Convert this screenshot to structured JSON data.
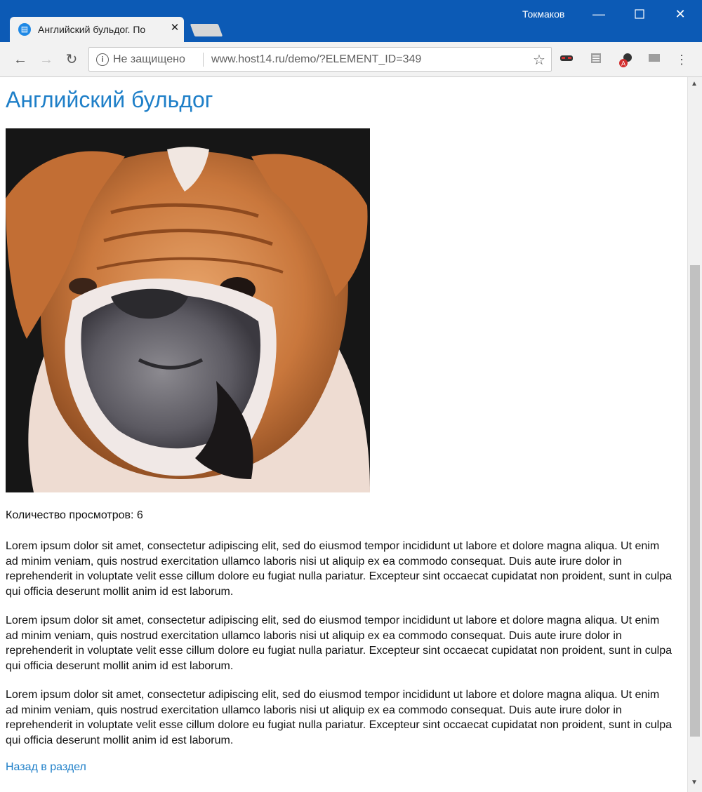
{
  "browser": {
    "tab_title": "Английский бульдог. По",
    "tab_close": "✕",
    "profile_name": "Токмаков",
    "security_text": "Не защищено",
    "url": "www.host14.ru/demo/?ELEMENT_ID=349",
    "accent_color": "#0c5ab5"
  },
  "page": {
    "title": "Английский бульдог",
    "views": "Количество просмотров: 6",
    "paragraphs": [
      "Lorem ipsum dolor sit amet, consectetur adipiscing elit, sed do eiusmod tempor incididunt ut labore et dolore magna aliqua. Ut enim ad minim veniam, quis nostrud exercitation ullamco laboris nisi ut aliquip ex ea commodo consequat. Duis aute irure dolor in reprehenderit in voluptate velit esse cillum dolore eu fugiat nulla pariatur. Excepteur sint occaecat cupidatat non proident, sunt in culpa qui officia deserunt mollit anim id est laborum.",
      "Lorem ipsum dolor sit amet, consectetur adipiscing elit, sed do eiusmod tempor incididunt ut labore et dolore magna aliqua. Ut enim ad minim veniam, quis nostrud exercitation ullamco laboris nisi ut aliquip ex ea commodo consequat. Duis aute irure dolor in reprehenderit in voluptate velit esse cillum dolore eu fugiat nulla pariatur. Excepteur sint occaecat cupidatat non proident, sunt in culpa qui officia deserunt mollit anim id est laborum.",
      "Lorem ipsum dolor sit amet, consectetur adipiscing elit, sed do eiusmod tempor incididunt ut labore et dolore magna aliqua. Ut enim ad minim veniam, quis nostrud exercitation ullamco laboris nisi ut aliquip ex ea commodo consequat. Duis aute irure dolor in reprehenderit in voluptate velit esse cillum dolore eu fugiat nulla pariatur. Excepteur sint occaecat cupidatat non proident, sunt in culpa qui officia deserunt mollit anim id est laborum."
    ],
    "back_link": "Назад в раздел",
    "link_color": "#1e7fc8"
  },
  "icons": {
    "favicon": "basket-icon",
    "back": "back-arrow-icon",
    "forward": "forward-arrow-icon",
    "reload": "reload-icon",
    "info": "info-icon",
    "bookmark": "star-icon",
    "menu": "kebab-menu-icon"
  }
}
